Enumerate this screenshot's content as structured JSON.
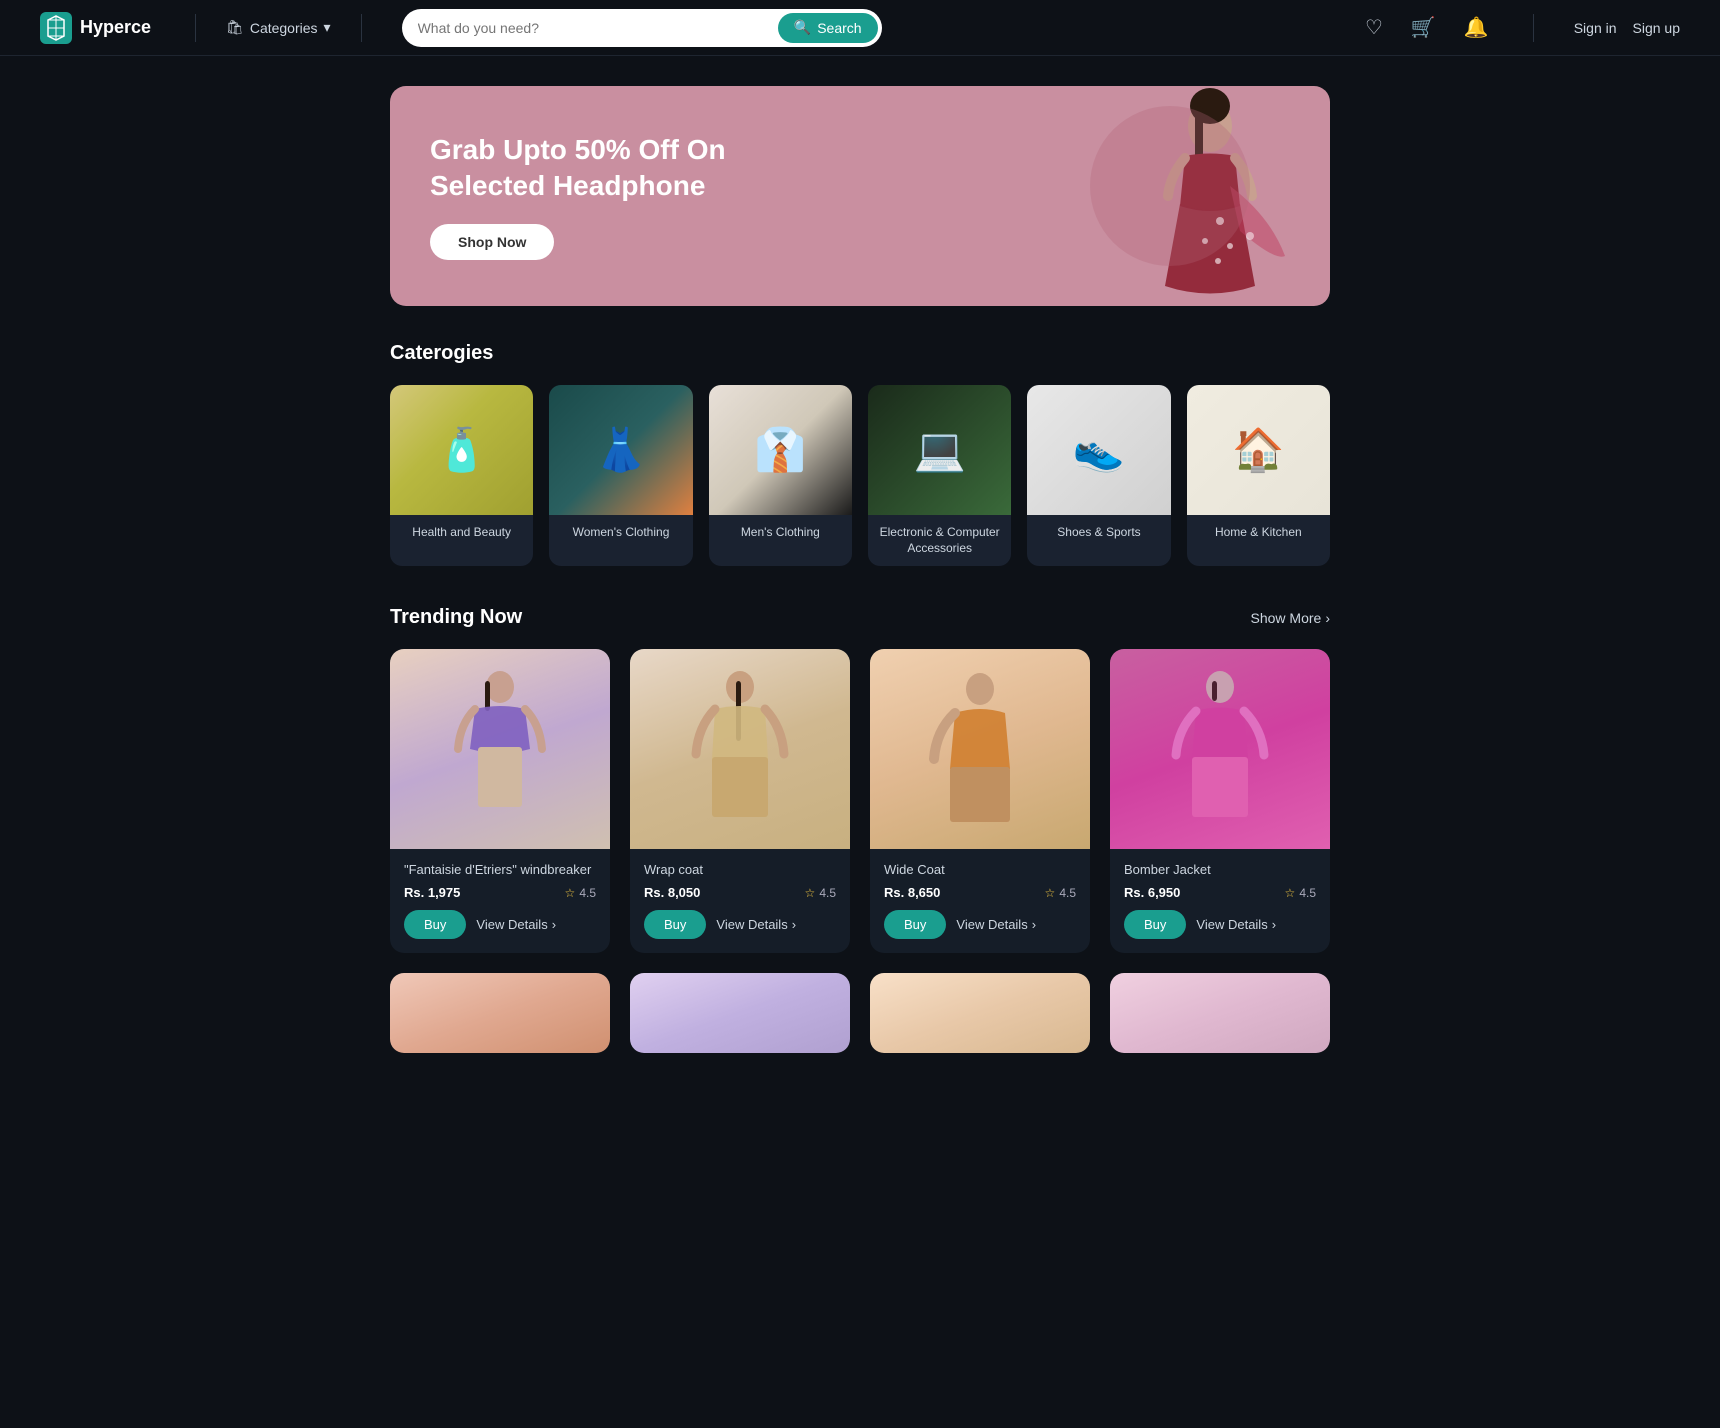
{
  "nav": {
    "logo_text": "Hyperce",
    "categories_label": "Categories",
    "search_placeholder": "What do you need?",
    "search_button": "Search",
    "signin_label": "Sign in",
    "signup_label": "Sign up"
  },
  "hero": {
    "title": "Grab Upto 50% Off On Selected Headphone",
    "cta_label": "Shop Now"
  },
  "categories": {
    "section_title": "Caterogies",
    "items": [
      {
        "label": "Health and Beauty",
        "emoji": "🧴"
      },
      {
        "label": "Women's Clothing",
        "emoji": "👗"
      },
      {
        "label": "Men's Clothing",
        "emoji": "👔"
      },
      {
        "label": "Electronic & Computer Accessories",
        "emoji": "💻"
      },
      {
        "label": "Shoes & Sports",
        "emoji": "👟"
      },
      {
        "label": "Home & Kitchen",
        "emoji": "🏠"
      }
    ]
  },
  "trending": {
    "section_title": "Trending Now",
    "show_more_label": "Show More",
    "products": [
      {
        "name": "\"Fantaisie d'Etriers\" windbreaker",
        "price": "Rs. 1,975",
        "rating": "4.5",
        "buy_label": "Buy",
        "view_label": "View Details"
      },
      {
        "name": "Wrap coat",
        "price": "Rs. 8,050",
        "rating": "4.5",
        "buy_label": "Buy",
        "view_label": "View Details"
      },
      {
        "name": "Wide Coat",
        "price": "Rs. 8,650",
        "rating": "4.5",
        "buy_label": "Buy",
        "view_label": "View Details"
      },
      {
        "name": "Bomber Jacket",
        "price": "Rs. 6,950",
        "rating": "4.5",
        "buy_label": "Buy",
        "view_label": "View Details"
      }
    ]
  },
  "colors": {
    "accent": "#1a9e8f",
    "hero_bg": "#c98fa0",
    "dark_bg": "#0d1117",
    "card_bg": "#151d28"
  }
}
